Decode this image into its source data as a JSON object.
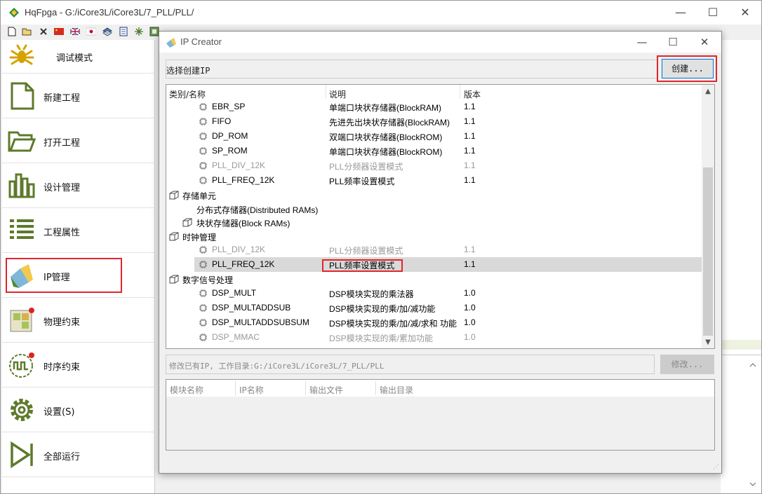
{
  "main_window": {
    "title": "HqFpga - G:/iCore3L/iCore3L/7_PLL/PLL/",
    "controls": {
      "minimize": "—",
      "maximize": "☐",
      "close": "✕"
    }
  },
  "toolbar": {
    "icons": [
      "new-file-icon",
      "open-folder-icon",
      "close-icon",
      "flag-china-icon",
      "flag-uk-icon",
      "flag-japan-icon",
      "layers-icon",
      "document-icon",
      "snowflake-icon",
      "chip-icon"
    ]
  },
  "sidebar": {
    "items": [
      {
        "label": "调试模式",
        "icon": "debug-icon"
      },
      {
        "label": "新建工程",
        "icon": "new-project-icon"
      },
      {
        "label": "打开工程",
        "icon": "open-project-icon"
      },
      {
        "label": "设计管理",
        "icon": "design-manage-icon"
      },
      {
        "label": "工程属性",
        "icon": "project-properties-icon"
      },
      {
        "label": "IP管理",
        "icon": "ip-manage-icon"
      },
      {
        "label": "物理约束",
        "icon": "physical-constraint-icon"
      },
      {
        "label": "时序约束",
        "icon": "timing-constraint-icon"
      },
      {
        "label": "设置(S)",
        "icon": "settings-icon"
      },
      {
        "label": "全部运行",
        "icon": "run-all-icon"
      }
    ]
  },
  "dialog": {
    "title": "IP Creator",
    "controls": {
      "minimize": "—",
      "maximize": "☐",
      "close": "✕"
    },
    "select_label": "选择创建IP",
    "create_button": "创建...",
    "tree": {
      "headers": {
        "name": "类别/名称",
        "desc": "说明",
        "version": "版本"
      },
      "rows": [
        {
          "kind": "ip",
          "name": "EBR_SP",
          "desc": "单端口块状存储器(BlockRAM)",
          "version": "1.1",
          "grey": false
        },
        {
          "kind": "ip",
          "name": "FIFO",
          "desc": "先进先出块状存储器(BlockRAM)",
          "version": "1.1",
          "grey": false
        },
        {
          "kind": "ip",
          "name": "DP_ROM",
          "desc": "双端口块状存储器(BlockROM)",
          "version": "1.1",
          "grey": false
        },
        {
          "kind": "ip",
          "name": "SP_ROM",
          "desc": "单端口块状存储器(BlockROM)",
          "version": "1.1",
          "grey": false
        },
        {
          "kind": "ip",
          "name": "PLL_DIV_12K",
          "desc": "PLL分频器设置模式",
          "version": "1.1",
          "grey": true
        },
        {
          "kind": "ip",
          "name": "PLL_FREQ_12K",
          "desc": "PLL频率设置模式",
          "version": "1.1",
          "grey": false
        },
        {
          "kind": "group",
          "name": "存储单元"
        },
        {
          "kind": "sub",
          "name": "分布式存储器(Distributed RAMs)"
        },
        {
          "kind": "subbox",
          "name": "块状存储器(Block RAMs)"
        },
        {
          "kind": "group",
          "name": "时钟管理"
        },
        {
          "kind": "ip",
          "name": "PLL_DIV_12K",
          "desc": "PLL分频器设置模式",
          "version": "1.1",
          "grey": true
        },
        {
          "kind": "ip",
          "name": "PLL_FREQ_12K",
          "desc": "PLL频率设置模式",
          "version": "1.1",
          "grey": false,
          "selected": true
        },
        {
          "kind": "group",
          "name": "数字信号处理"
        },
        {
          "kind": "ip",
          "name": "DSP_MULT",
          "desc": "DSP模块实现的乘法器",
          "version": "1.0",
          "grey": false
        },
        {
          "kind": "ip",
          "name": "DSP_MULTADDSUB",
          "desc": "DSP模块实现的乘/加/减功能",
          "version": "1.0",
          "grey": false
        },
        {
          "kind": "ip",
          "name": "DSP_MULTADDSUBSUM",
          "desc": "DSP模块实现的乘/加/减/求和 功能",
          "version": "1.0",
          "grey": false
        },
        {
          "kind": "ip",
          "name": "DSP_MMAC",
          "desc": "DSP模块实现的乘/累加功能",
          "version": "1.0",
          "grey": true
        }
      ]
    },
    "path_text": "修改已有IP, 工作目录:G:/iCore3L/iCore3L/7_PLL/PLL",
    "modify_button": "修改...",
    "table": {
      "headers": [
        "模块名称",
        "IP名称",
        "输出文件",
        "输出目录"
      ]
    }
  }
}
